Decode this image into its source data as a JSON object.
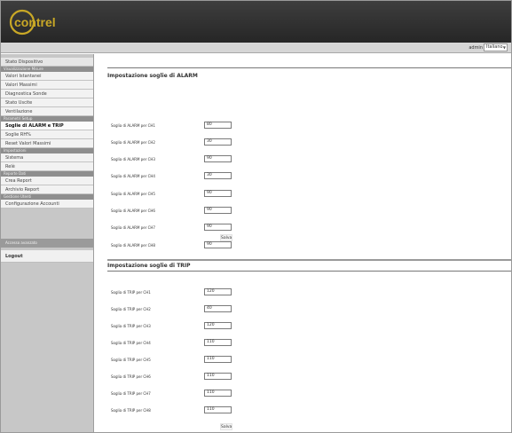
{
  "app": {
    "logo_text": "contrel"
  },
  "userbar": {
    "user": "admin",
    "language": "Italiano"
  },
  "sidebar": {
    "top_item": "Stato Dispositivo",
    "groups": [
      {
        "title": "Visualizzazione Misure",
        "items": [
          "Valori Istantanei",
          "Valori Massimi",
          "Diagnostica Sonde",
          "Stato Uscite",
          "Ventilazione"
        ]
      },
      {
        "title": "Parametri Setup",
        "items": [
          "Soglie di ALARM e TRIP",
          "Soglie RH%",
          "Reset Valori Massimi"
        ]
      },
      {
        "title": "Impostazioni",
        "items": [
          "Sistema",
          "Relè"
        ]
      },
      {
        "title": "Reporte Dati",
        "items": [
          "Crea Report",
          "Archivio Report"
        ]
      },
      {
        "title": "Gestione Utenti",
        "items": [
          "Configurazione Accounti"
        ]
      }
    ],
    "active_item": "Soglie di ALARM e TRIP",
    "advanced_section": "Accesso avanzato",
    "logout": "Logout"
  },
  "alarm": {
    "title": "Impostazione soglie di ALARM",
    "rows": [
      {
        "label": "Soglia di ALARM per CH1",
        "value": "80"
      },
      {
        "label": "Soglia di ALARM per CH2",
        "value": "30"
      },
      {
        "label": "Soglia di ALARM per CH3",
        "value": "90"
      },
      {
        "label": "Soglia di ALARM per CH4",
        "value": "30"
      },
      {
        "label": "Soglia di ALARM per CH5",
        "value": "90"
      },
      {
        "label": "Soglia di ALARM per CH6",
        "value": "90"
      },
      {
        "label": "Soglia di ALARM per CH7",
        "value": "90"
      },
      {
        "label": "Soglia di ALARM per CH8",
        "value": "90"
      }
    ],
    "save_label": "Salva"
  },
  "trip": {
    "title": "Impostazione soglie di TRIP",
    "rows": [
      {
        "label": "Soglia di TRIP per CH1",
        "value": "120"
      },
      {
        "label": "Soglia di TRIP per CH2",
        "value": "40"
      },
      {
        "label": "Soglia di TRIP per CH3",
        "value": "120"
      },
      {
        "label": "Soglia di TRIP per CH4",
        "value": "110"
      },
      {
        "label": "Soglia di TRIP per CH5",
        "value": "110"
      },
      {
        "label": "Soglia di TRIP per CH6",
        "value": "110"
      },
      {
        "label": "Soglia di TRIP per CH7",
        "value": "110"
      },
      {
        "label": "Soglia di TRIP per CH8",
        "value": "110"
      }
    ],
    "save_label": "Salva"
  },
  "colors": {
    "header": "#2e2e2e",
    "sidebar": "#c7c7c7",
    "logo_gold": "#c9a826"
  }
}
